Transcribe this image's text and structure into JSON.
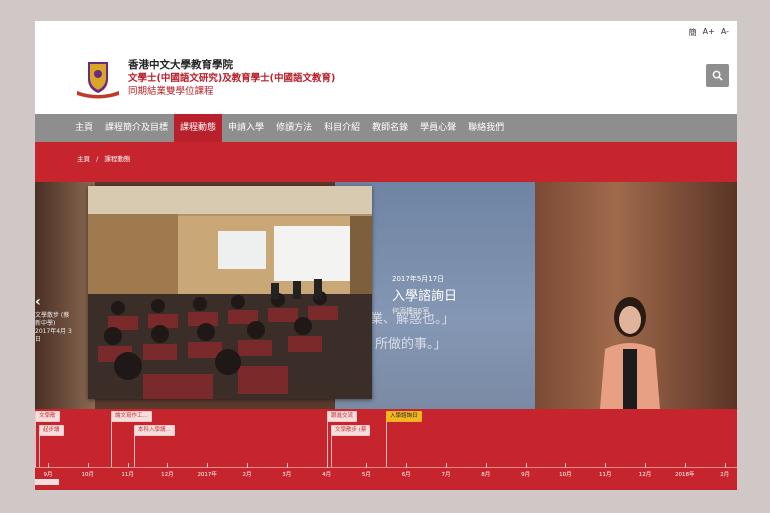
{
  "topbar": {
    "simplified": "簡",
    "font_up": "A+",
    "font_down": "A-"
  },
  "header": {
    "title": "香港中文大學教育學院",
    "subtitle1": "文學士(中國語文研究)及教育學士(中國語文教育)",
    "subtitle2": "同期結業雙學位課程"
  },
  "nav": {
    "items": [
      "主頁",
      "課程簡介及目標",
      "課程動態",
      "申請入學",
      "修讀方法",
      "科目介紹",
      "教師名錄",
      "學員心聲",
      "聯絡我們"
    ],
    "active_index": 2
  },
  "breadcrumb": {
    "home": "主頁",
    "sep": "/",
    "current": "課程動態"
  },
  "hero": {
    "slide": {
      "date": "2017年5月17日",
      "title": "入學諮詢日",
      "location": "何添樓B6室"
    },
    "prev": {
      "line1": "文學散步 (蔡",
      "line2": "新中學)",
      "line3": "2017年4月 3日"
    },
    "screen_line1": "受業、解惑也。」",
    "screen_line2": "所做的事。」"
  },
  "timeline": {
    "flags": [
      {
        "label": "文學散",
        "row": 0,
        "active": false
      },
      {
        "label": "起步讀",
        "row": 1,
        "active": false
      },
      {
        "label": "論文寫作工...",
        "row": 0,
        "active": false
      },
      {
        "label": "本科入學講...",
        "row": 1,
        "active": false
      },
      {
        "label": "跟進交流",
        "row": 0,
        "active": false
      },
      {
        "label": "文學散步 (蔡",
        "row": 1,
        "active": false
      },
      {
        "label": "入學諮詢日",
        "row": 0,
        "active": true
      }
    ],
    "months": [
      "9月",
      "10月",
      "11月",
      "12月",
      "2017年",
      "2月",
      "3月",
      "4月",
      "5月",
      "6月",
      "7月",
      "8月",
      "9月",
      "10月",
      "11月",
      "12月",
      "2018年",
      "2月"
    ],
    "year_labels": [
      "2017年",
      "2018年"
    ]
  },
  "colors": {
    "brand_red": "#c7252e",
    "nav_gray": "#8e8e8e",
    "active_flag": "#f6b520"
  }
}
